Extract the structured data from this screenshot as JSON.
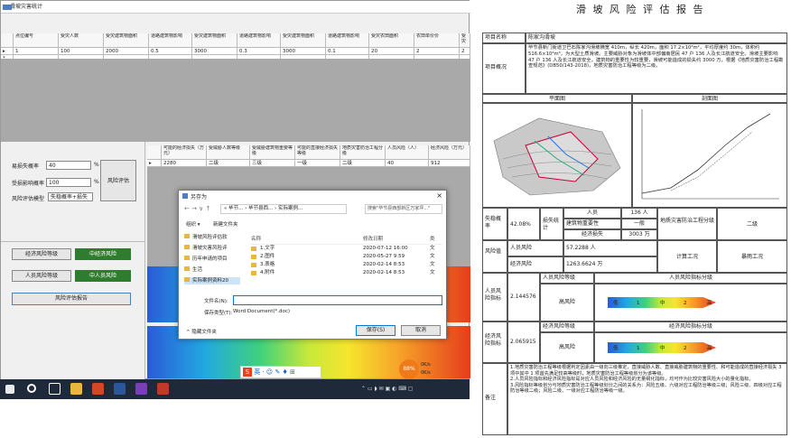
{
  "app": {
    "title": "滑坡灾害统计",
    "table1": {
      "headers": [
        "",
        "点位编号",
        "受灾人数",
        "受灾建筑物面积",
        "道路建筑物影响",
        "受灾建筑物面积",
        "道路建筑物影响",
        "受灾建筑物面积",
        "道路建筑物影响",
        "受灾农田面积",
        "农田单价价",
        "受灾"
      ],
      "rows": [
        [
          "▸",
          "1",
          "100",
          "2000",
          "0.5",
          "3000",
          "0.3",
          "3000",
          "0.1",
          "20",
          "2",
          "2"
        ],
        [
          "*",
          "",
          "",
          "",
          "",
          "",
          "",
          "",
          "",
          "",
          "",
          ""
        ]
      ]
    },
    "table2": {
      "headers": [
        "",
        "可能的经济损失（万元）",
        "受威胁人数等级",
        "受威胁建筑物重要等级",
        "可能的直接经济损失等级",
        "地质灾害防治工程分级",
        "人员风险（人）",
        "经济风险（万元）"
      ],
      "rows": [
        [
          "▸",
          "2280",
          "二级",
          "三级",
          "一级",
          "二级",
          "40",
          "912"
        ]
      ]
    },
    "left_panel": {
      "loss_rate_label": "易损失概率",
      "loss_rate_value": "40",
      "loss_rate_unit": "%",
      "impact_label": "受损影响概率",
      "impact_value": "100",
      "impact_unit": "%",
      "model_label": "风险评估模型",
      "model_value": "失稳概率+损失",
      "assess_button": "风险评估",
      "econ_level_button": "经济风险等级",
      "econ_level_value": "中经济风险",
      "person_level_button": "人员风险等级",
      "person_level_value": "中人员风险",
      "report_button": "风险评估报告"
    },
    "color_bar": {
      "labels": [
        "低",
        "1",
        "中",
        "2",
        "高"
      ]
    },
    "dialog": {
      "title": "另存为",
      "path": [
        "« 毕节...",
        "毕节县西...",
        "实际案例..."
      ],
      "search_placeholder": "搜索\"毕节县西部新区万家坪...\"",
      "organize": "组织 ▾",
      "new_folder": "新建文件夹",
      "tree": [
        "滑坡风险评估软",
        "滑坡灾害风险评",
        "历年申请的项目",
        "生活",
        "实际案例资料20"
      ],
      "cols": [
        "名称",
        "修改日期",
        "类"
      ],
      "files": [
        [
          "1.文字",
          "2020-07-12 16:00",
          "文"
        ],
        [
          "2.图件",
          "2020-05-27 9:59",
          "文"
        ],
        [
          "3.表格",
          "2020-02-14 8:53",
          "文"
        ],
        [
          "4.附件",
          "2020-02-14 8:53",
          "文"
        ]
      ],
      "filename_label": "文件名(N):",
      "filename_value": "",
      "type_label": "保存类型(T):",
      "type_value": "Word Document(*.doc)",
      "hide_folders": "^ 隐藏文件夹",
      "save": "保存(S)",
      "cancel": "取消"
    },
    "ime": {
      "label": "英"
    },
    "badge": {
      "value": "88%",
      "up": "0K/s",
      "down": "0K/s"
    }
  },
  "report": {
    "title": "滑 坡 风 险 评 估 报 告",
    "name_label": "项目名称",
    "name_value": "陈家沟滑坡",
    "overview_label": "项目概况",
    "overview_text": "毕节县新门街道卫巴石陈家沟滑坡横宽 410m，纵长 420m，面积 17.2×10⁴m²，平均厚度约 30m，体积约 516.6×10⁴m³，为大型土质滑坡。主要威胁对象为滑坡体中部偏南居民 47 户 136 人及长江航道安全。滑坡主要影响 47 户 136 人及长江航道安全，建筑物的重要性为较重要，滑坡可能造成的损失约 3000 万，根据《地质灾害防治工程勘查规范》(DB50/143-2018)，地质灾害防治工程等级为二级。",
    "plan_label": "平面图",
    "section_label": "剖面图",
    "fail_prob_label": "失稳概率",
    "fail_prob_value": "42.08%",
    "loss_label": "损失统计",
    "persons_label": "人员",
    "persons_value": "136 人",
    "bldg_label": "建筑物重要性",
    "bldg_value": "一般",
    "econ_loss_label": "经济损失",
    "econ_loss_value": "3003 万",
    "grade_label": "地质灾害防治工程分级",
    "grade_value": "二级",
    "risk_value_label": "风险值",
    "person_risk_label": "人员风险",
    "person_risk_value": "57.2288 人",
    "econ_risk_label": "经济风险",
    "econ_risk_value": "1263.6624 万",
    "calc_label": "计算工况",
    "calc_value": "暴雨工况",
    "pr_index_label": "人员风险指标",
    "pr_index_value": "2.144576",
    "pr_level_head": "人员风险等级",
    "pr_bar_head": "人员风险指标分级",
    "pr_level": "高风险",
    "er_index_label": "经济风险指标",
    "er_index_value": "2.065915",
    "er_level_head": "经济风险等级",
    "er_bar_head": "经济风险指标分级",
    "er_level": "高风险",
    "bar_ticks": [
      "低",
      "1",
      "中",
      "2",
      "高"
    ],
    "notes_label": "备注",
    "notes": [
      "1.地质灾害防治工程等级根据判定因素由一级向三级推定，直接威胁人数、直接威胁建筑物的重要性、和可能造成的直接经济损失 3 项中其中 1 项首先满足较高等级时，地质灾害防治工程等级划分为该等级。",
      "2.人员风险指标和经济风险指标是对应人员风险和经济风险的无量纲化指标，均可作为比较灾害风险大小的量化指标。",
      "3.风险指标等级划分与地质灾害防治工程等级划分之间的关系为：风险五级、六级对应工程防治等级三级；风险三级、四级对应工程防治等级二级；风险二级、一级对应工程防治等级一级。"
    ]
  },
  "colors": {
    "green": "#2e7d2e",
    "taskbar": "#1e2a3a",
    "accent": "#0078d7"
  }
}
